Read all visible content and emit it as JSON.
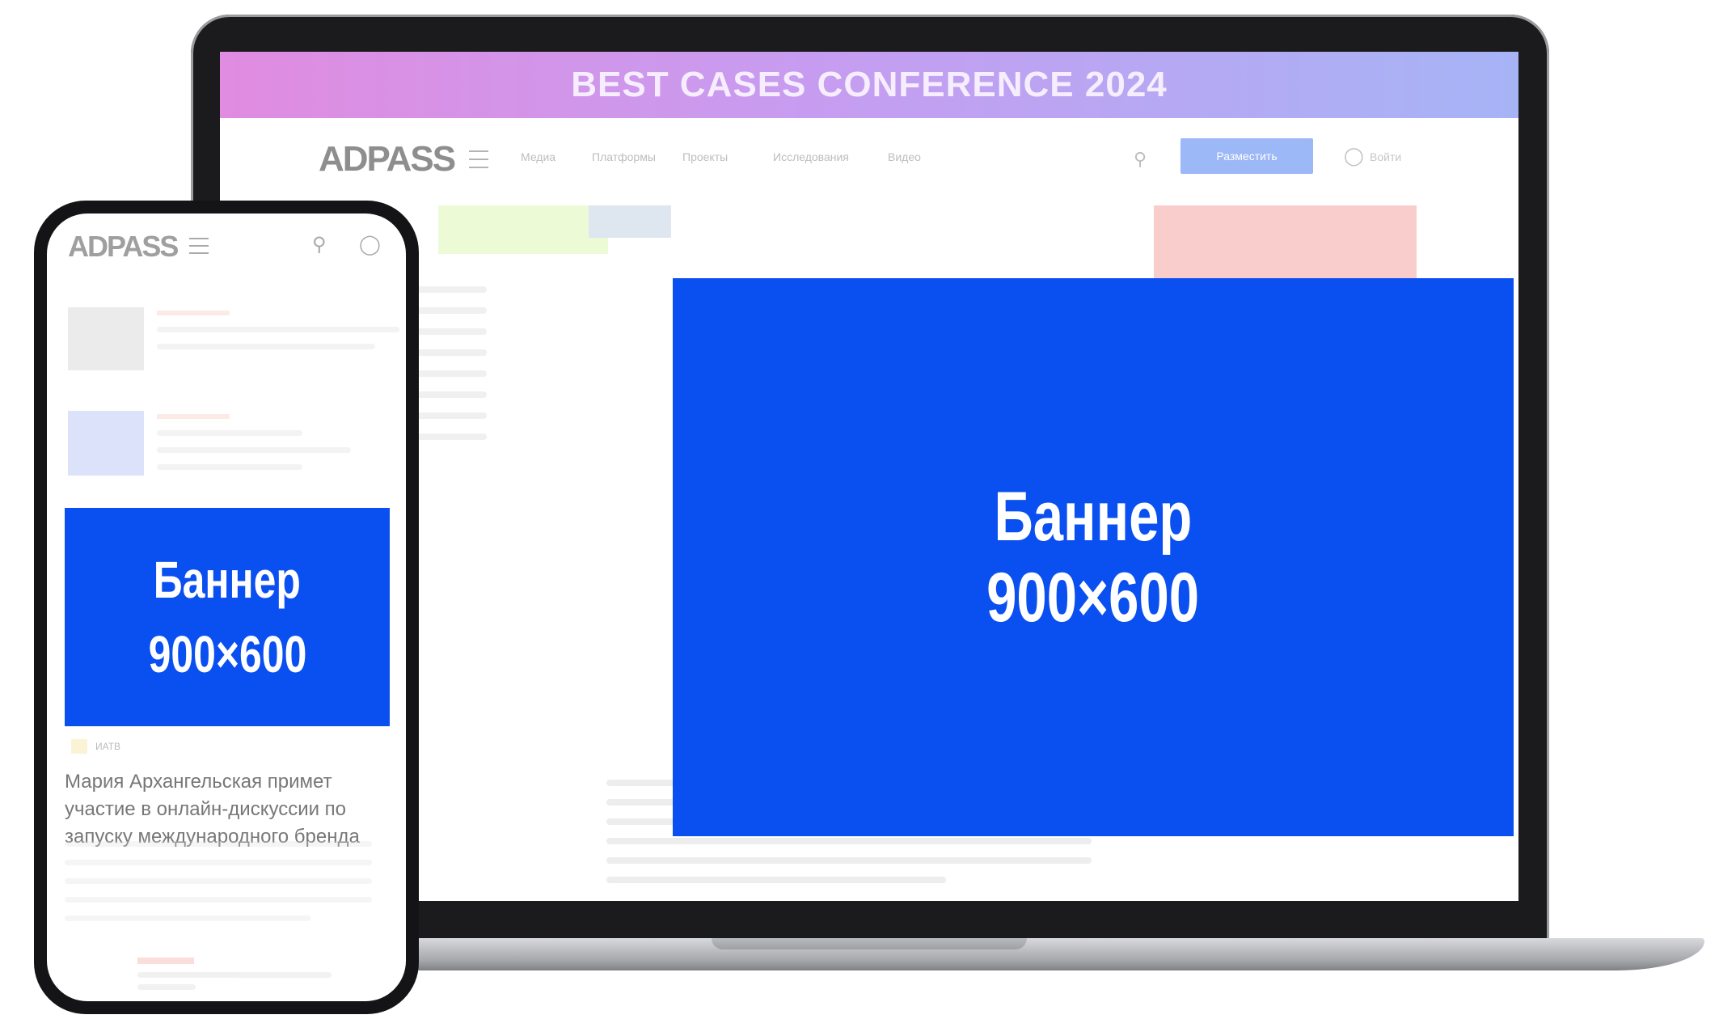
{
  "laptop": {
    "promo_text": "BEST CASES CONFERENCE 2024",
    "logo": "ADPASS",
    "nav": [
      "Медиа",
      "Платформы",
      "Проекты",
      "Исследования",
      "Видео"
    ],
    "action_button": "Разместить",
    "login_label": "Войти",
    "banner": {
      "line1": "Баннер",
      "line2": "900×600"
    }
  },
  "phone": {
    "logo": "ADPASS",
    "banner": {
      "line1": "Баннер",
      "line2": "900×600"
    },
    "article_badge": "ИАТВ",
    "article_title": "Мария Архангельская примет участие в онлайн-дискуссии по запуску международного бренда"
  },
  "colors": {
    "banner": "#0a4ff0",
    "promo_gradient_start": "#e08ce0",
    "promo_gradient_end": "#a6b4f6",
    "action_button": "#4c7ff0"
  }
}
